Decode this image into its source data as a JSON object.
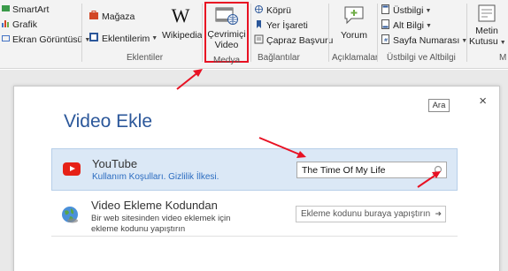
{
  "ribbon": {
    "smartart": "SmartArt",
    "grafik": "Grafik",
    "ekran_goruntusu": "Ekran Görüntüsü",
    "magaza": "Mağaza",
    "eklentilerim": "Eklentilerim",
    "wikipedia": "Wikipedia",
    "cevrimici_line1": "Çevrimiçi",
    "cevrimici_line2": "Video",
    "kopru": "Köprü",
    "yer_isareti": "Yer İşareti",
    "capraz_basvuru": "Çapraz Başvuru",
    "yorum": "Yorum",
    "ustbilgi": "Üstbilgi",
    "alt_bilgi": "Alt Bilgi",
    "sayfa_numarasi": "Sayfa Numarası",
    "metin_line1": "Metin",
    "metin_line2": "Kutusu",
    "groups": {
      "eklentiler": "Eklentiler",
      "medya": "Medya",
      "baglantilar": "Bağlantılar",
      "aciklamalar": "Açıklamalar",
      "ustbilgi_altbilgi": "Üstbilgi ve Altbilgi",
      "more": "M"
    },
    "colors": {
      "highlight": "#e81123",
      "accent": "#2b579a"
    }
  },
  "dialog": {
    "title": "Video Ekle",
    "close": "×",
    "youtube": {
      "title": "YouTube",
      "terms_link": "Kullanım Koşulları.",
      "privacy_link": "Gizlilik İlkesi.",
      "search_value": "The Time Of My Life",
      "tooltip": "Ara"
    },
    "embed": {
      "title": "Video Ekleme Kodundan",
      "description": "Bir web sitesinden video eklemek için ekleme kodunu yapıştırın",
      "placeholder": "Ekleme kodunu buraya yapıştırın",
      "arrow": "➜"
    }
  }
}
